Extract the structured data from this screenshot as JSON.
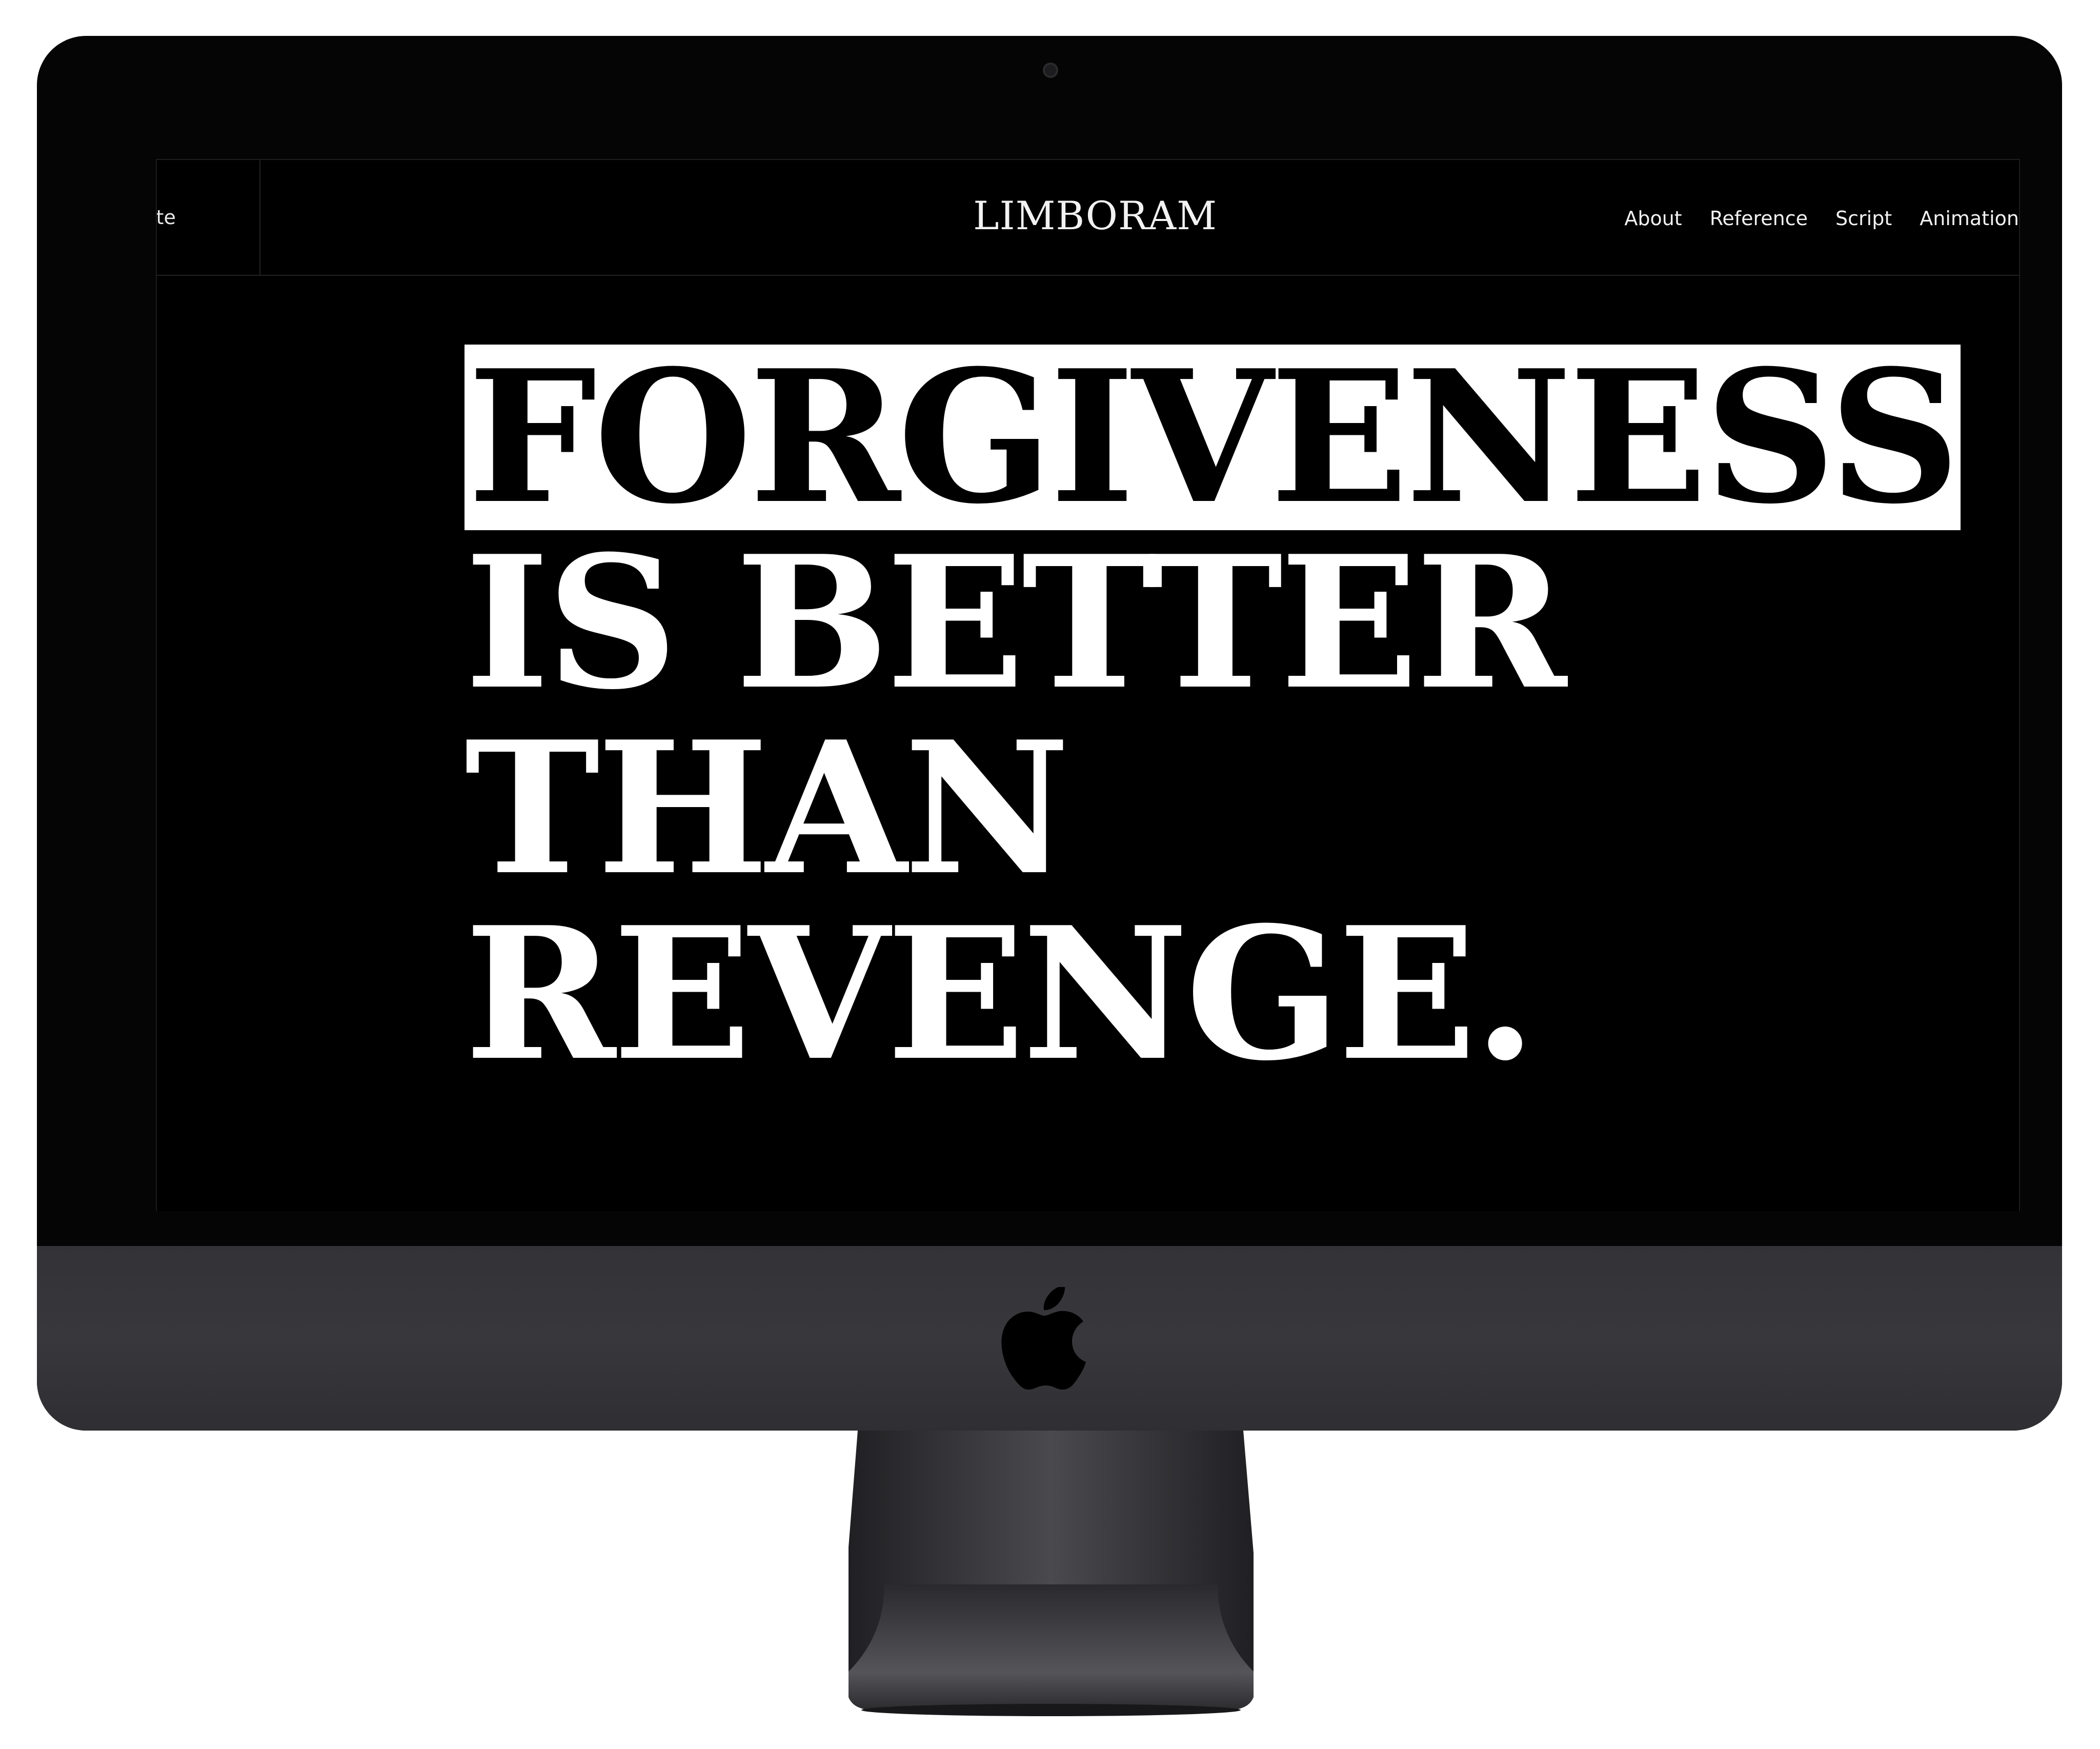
{
  "header": {
    "side_label": "ite",
    "brand": "LIMBORAM",
    "nav": [
      "About",
      "Reference",
      "Script",
      "Animation"
    ]
  },
  "hero": {
    "lines": [
      "FORGIVENESS",
      "IS BETTER",
      "THAN",
      "REVENGE."
    ],
    "highlight_color": "#ffffff",
    "text_color": "#ffffff",
    "background": "#000000"
  },
  "device": {
    "icons": [
      "camera-icon",
      "apple-logo-icon"
    ]
  }
}
